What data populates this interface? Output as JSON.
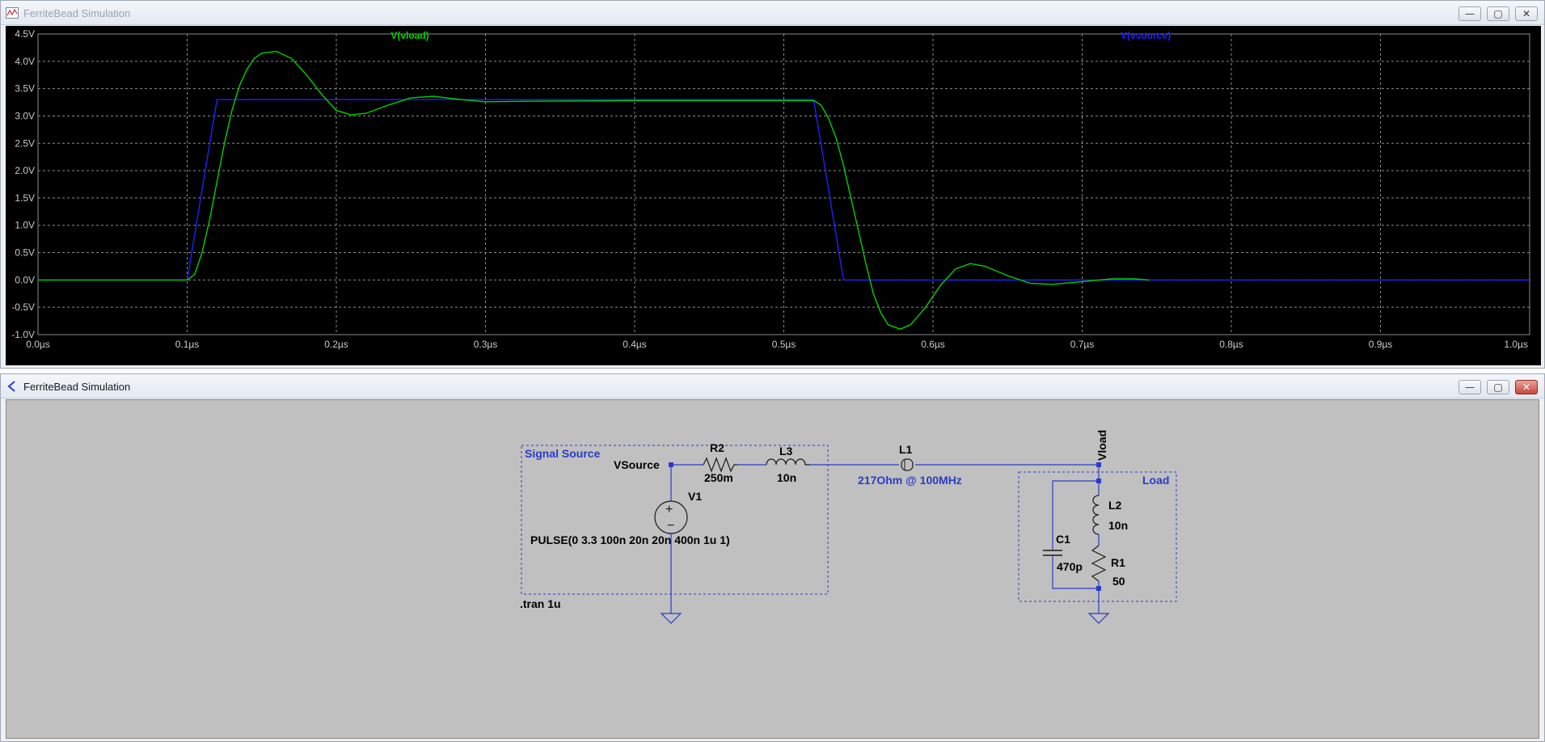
{
  "plot_window": {
    "title": "FerriteBead Simulation",
    "buttons": {
      "minimize": "—",
      "maximize": "▢",
      "close": "✕"
    }
  },
  "schematic_window": {
    "title": "FerriteBead Simulation",
    "buttons": {
      "minimize": "—",
      "maximize": "▢",
      "close": "✕"
    }
  },
  "colors": {
    "vload": "#00d000",
    "vsource": "#2020ff",
    "grid": "#8a8a8a",
    "axis_text": "#c8c8c8",
    "wire": "#2a3cc8"
  },
  "chart_data": {
    "type": "line",
    "title": "",
    "xlabel": "",
    "ylabel": "",
    "xlim": [
      0,
      1.0
    ],
    "ylim": [
      -1.0,
      4.5
    ],
    "grid": true,
    "x_ticks": [
      "0.0µs",
      "0.1µs",
      "0.2µs",
      "0.3µs",
      "0.4µs",
      "0.5µs",
      "0.6µs",
      "0.7µs",
      "0.8µs",
      "0.9µs",
      "1.0µs"
    ],
    "y_ticks": [
      "4.5V",
      "4.0V",
      "3.5V",
      "3.0V",
      "2.5V",
      "2.0V",
      "1.5V",
      "1.0V",
      "0.5V",
      "0.0V",
      "-0.5V",
      "-1.0V"
    ],
    "series": [
      {
        "name": "V(vload)",
        "color": "#00d000",
        "points": [
          [
            0.0,
            0.0
          ],
          [
            0.1,
            0.0
          ],
          [
            0.105,
            0.1
          ],
          [
            0.11,
            0.5
          ],
          [
            0.115,
            1.1
          ],
          [
            0.12,
            1.8
          ],
          [
            0.125,
            2.5
          ],
          [
            0.13,
            3.1
          ],
          [
            0.135,
            3.55
          ],
          [
            0.14,
            3.85
          ],
          [
            0.145,
            4.05
          ],
          [
            0.15,
            4.15
          ],
          [
            0.16,
            4.18
          ],
          [
            0.17,
            4.05
          ],
          [
            0.18,
            3.75
          ],
          [
            0.19,
            3.4
          ],
          [
            0.2,
            3.1
          ],
          [
            0.21,
            3.02
          ],
          [
            0.22,
            3.05
          ],
          [
            0.235,
            3.2
          ],
          [
            0.25,
            3.33
          ],
          [
            0.265,
            3.36
          ],
          [
            0.28,
            3.31
          ],
          [
            0.3,
            3.26
          ],
          [
            0.33,
            3.27
          ],
          [
            0.4,
            3.28
          ],
          [
            0.5,
            3.28
          ],
          [
            0.52,
            3.28
          ],
          [
            0.525,
            3.2
          ],
          [
            0.53,
            2.95
          ],
          [
            0.535,
            2.6
          ],
          [
            0.54,
            2.1
          ],
          [
            0.545,
            1.5
          ],
          [
            0.55,
            0.9
          ],
          [
            0.555,
            0.3
          ],
          [
            0.56,
            -0.25
          ],
          [
            0.565,
            -0.6
          ],
          [
            0.57,
            -0.82
          ],
          [
            0.578,
            -0.9
          ],
          [
            0.585,
            -0.82
          ],
          [
            0.595,
            -0.5
          ],
          [
            0.605,
            -0.1
          ],
          [
            0.615,
            0.2
          ],
          [
            0.625,
            0.3
          ],
          [
            0.635,
            0.25
          ],
          [
            0.65,
            0.08
          ],
          [
            0.665,
            -0.06
          ],
          [
            0.68,
            -0.08
          ],
          [
            0.7,
            -0.03
          ],
          [
            0.72,
            0.02
          ],
          [
            0.735,
            0.02
          ],
          [
            0.745,
            0.0
          ]
        ]
      },
      {
        "name": "V(vsource)",
        "color": "#2020ff",
        "points": [
          [
            0.0,
            0.0
          ],
          [
            0.1,
            0.0
          ],
          [
            0.12,
            3.3
          ],
          [
            0.52,
            3.3
          ],
          [
            0.54,
            0.0
          ],
          [
            1.0,
            0.0
          ]
        ]
      }
    ]
  },
  "schematic": {
    "block_signal_source": "Signal Source",
    "block_load": "Load",
    "net_vsource": "VSource",
    "net_vload": "Vload",
    "r2_name": "R2",
    "r2_value": "250m",
    "l3_name": "L3",
    "l3_value": "10n",
    "l1_name": "L1",
    "l1_value": "217Ohm @ 100MHz",
    "v1_name": "V1",
    "v1_value": "PULSE(0 3.3 100n 20n 20n 400n 1u 1)",
    "l2_name": "L2",
    "l2_value": "10n",
    "c1_name": "C1",
    "c1_value": "470p",
    "r1_name": "R1",
    "r1_value": "50",
    "directive": ".tran 1u"
  }
}
